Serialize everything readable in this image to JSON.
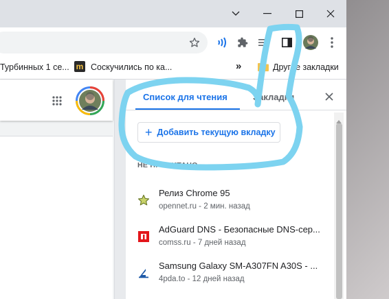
{
  "window": {
    "controls": [
      {
        "name": "tab-search-button",
        "icon": "chevron-down-icon"
      },
      {
        "name": "minimize-button",
        "icon": "minimize-icon"
      },
      {
        "name": "maximize-button",
        "icon": "maximize-icon"
      },
      {
        "name": "close-window-button",
        "icon": "close-icon"
      }
    ]
  },
  "toolbar": {
    "icons": [
      "star-icon",
      "yandex-voice-icon",
      "puzzle-icon",
      "reading-list-icon",
      "side-panel-icon",
      "avatar",
      "more-icon"
    ]
  },
  "bookmarks": {
    "item1": "Турбинных 1 се...",
    "item2": "Соскучились по ка...",
    "item2_icon_letter": "m",
    "overflow": "»",
    "other": "Другие закладки"
  },
  "panel": {
    "tab_reading_list": "Список для чтения",
    "tab_bookmarks": "Закладки",
    "add_button": "Добавить текущую вкладку",
    "add_icon": "+",
    "section_unread": "НЕ ПРОЧИТАНО",
    "items": [
      {
        "title": "Релиз Chrome 95",
        "subtitle": "opennet.ru - 2 мин. назад",
        "icon": "star-favicon-icon"
      },
      {
        "title": "AdGuard DNS - Безопасные DNS-сер...",
        "subtitle": "comss.ru - 7 дней назад",
        "icon": "comss-favicon-icon"
      },
      {
        "title": "Samsung Galaxy SM-A307FN A30S - ...",
        "subtitle": "4pda.to - 12 дней назад",
        "icon": "4pda-favicon-icon"
      }
    ],
    "close_icon": "close-icon"
  },
  "colors": {
    "accent": "#1a73e8",
    "annotation": "#7dd3f0",
    "comss_red": "#e3161b",
    "pda_blue": "#1e5aa8"
  }
}
